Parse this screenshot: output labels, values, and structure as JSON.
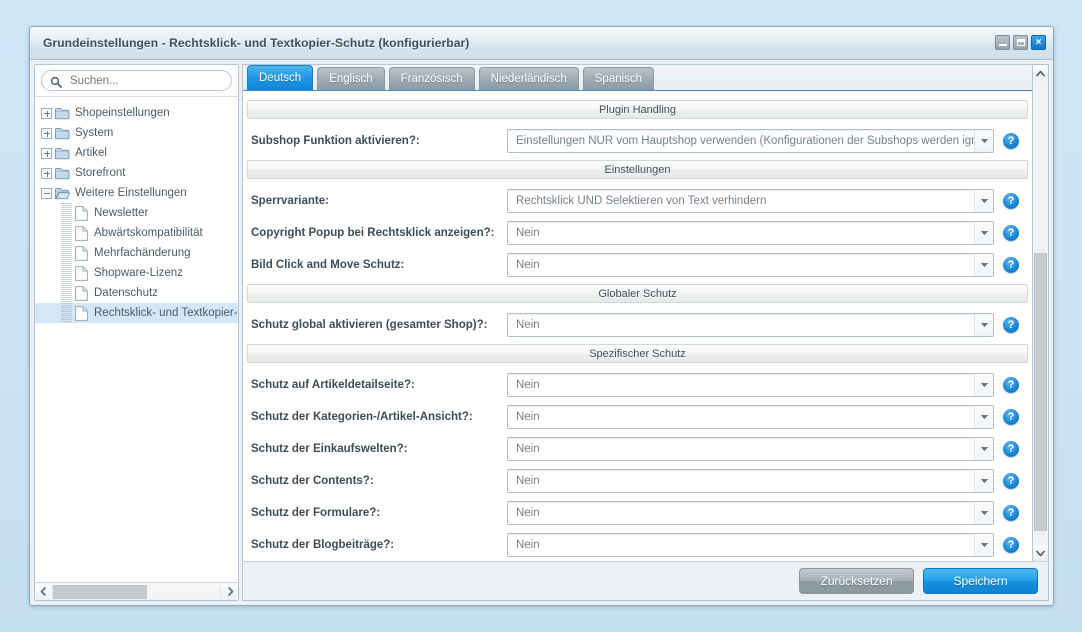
{
  "window": {
    "title": "Grundeinstellungen - Rechtsklick- und Textkopier-Schutz (konfigurierbar)",
    "minimize_label": "Minimieren",
    "maximize_label": "Maximieren",
    "close_label": "×"
  },
  "sidebar": {
    "search": {
      "placeholder": "Suchen...",
      "value": ""
    },
    "tree": [
      {
        "label": "Shopeinstellungen",
        "type": "folder",
        "expanded": false,
        "level": 0
      },
      {
        "label": "System",
        "type": "folder",
        "expanded": false,
        "level": 0
      },
      {
        "label": "Artikel",
        "type": "folder",
        "expanded": false,
        "level": 0
      },
      {
        "label": "Storefront",
        "type": "folder",
        "expanded": false,
        "level": 0
      },
      {
        "label": "Weitere Einstellungen",
        "type": "folder",
        "expanded": true,
        "level": 0
      },
      {
        "label": "Newsletter",
        "type": "file",
        "level": 1
      },
      {
        "label": "Abwärtskompatibilität",
        "type": "file",
        "level": 1
      },
      {
        "label": "Mehrfachänderung",
        "type": "file",
        "level": 1
      },
      {
        "label": "Shopware-Lizenz",
        "type": "file",
        "level": 1
      },
      {
        "label": "Datenschutz",
        "type": "file",
        "level": 1
      },
      {
        "label": "Rechtsklick- und Textkopier-Sc",
        "type": "file",
        "level": 1,
        "selected": true
      }
    ]
  },
  "tabs": [
    {
      "label": "Deutsch",
      "active": true
    },
    {
      "label": "Englisch",
      "active": false
    },
    {
      "label": "Französisch",
      "active": false
    },
    {
      "label": "Niederländisch",
      "active": false
    },
    {
      "label": "Spanisch",
      "active": false
    }
  ],
  "form": [
    {
      "kind": "section",
      "title": "Plugin Handling"
    },
    {
      "kind": "field",
      "label": "Subshop Funktion aktivieren?:",
      "value": "Einstellungen NUR vom Hauptshop verwenden (Konfigurationen der Subshops werden ignorier",
      "help": "?"
    },
    {
      "kind": "section",
      "title": "Einstellungen"
    },
    {
      "kind": "field",
      "label": "Sperrvariante:",
      "value": "Rechtsklick UND Selektieren von Text verhindern",
      "help": "?"
    },
    {
      "kind": "field",
      "label": "Copyright Popup bei Rechtsklick anzeigen?:",
      "value": "Nein",
      "help": "?"
    },
    {
      "kind": "field",
      "label": "Bild Click and Move Schutz:",
      "value": "Nein",
      "help": "?"
    },
    {
      "kind": "section",
      "title": "Globaler Schutz"
    },
    {
      "kind": "field",
      "label": "Schutz global aktivieren (gesamter Shop)?:",
      "value": "Nein",
      "help": "?"
    },
    {
      "kind": "section",
      "title": "Spezifischer Schutz"
    },
    {
      "kind": "field",
      "label": "Schutz auf Artikeldetailseite?:",
      "value": "Nein",
      "help": "?"
    },
    {
      "kind": "field",
      "label": "Schutz der Kategorien-/Artikel-Ansicht?:",
      "value": "Nein",
      "help": "?"
    },
    {
      "kind": "field",
      "label": "Schutz der Einkaufswelten?:",
      "value": "Nein",
      "help": "?"
    },
    {
      "kind": "field",
      "label": "Schutz der Contents?:",
      "value": "Nein",
      "help": "?"
    },
    {
      "kind": "field",
      "label": "Schutz der Formulare?:",
      "value": "Nein",
      "help": "?"
    },
    {
      "kind": "field",
      "label": "Schutz der Blogbeiträge?:",
      "value": "Nein",
      "help": "?"
    }
  ],
  "footer": {
    "reset_label": "Zurücksetzen",
    "save_label": "Speichern"
  },
  "colors": {
    "accent": "#1f96e4",
    "titlebar": "#d6e5ef",
    "desktop": "#cbe3f3",
    "selection": "#d3e7f7"
  }
}
